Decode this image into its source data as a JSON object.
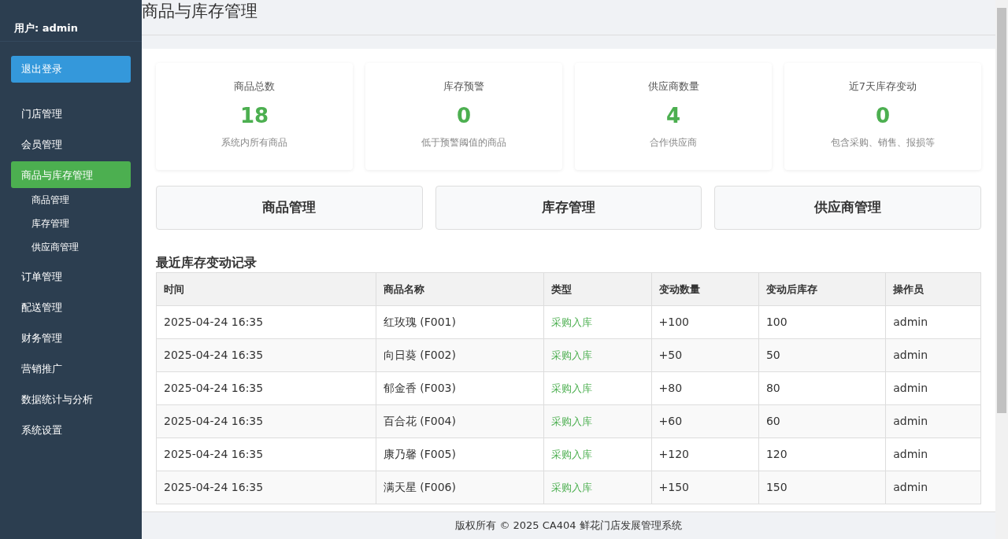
{
  "sidebar": {
    "user": "用户: admin",
    "logout": "退出登录",
    "items": [
      {
        "label": "门店管理",
        "selected": false
      },
      {
        "label": "会员管理",
        "selected": false
      },
      {
        "label": "商品与库存管理",
        "selected": true,
        "children": [
          {
            "label": "商品管理"
          },
          {
            "label": "库存管理"
          },
          {
            "label": "供应商管理"
          }
        ]
      },
      {
        "label": "订单管理",
        "selected": false
      },
      {
        "label": "配送管理",
        "selected": false
      },
      {
        "label": "财务管理",
        "selected": false
      },
      {
        "label": "营销推广",
        "selected": false
      },
      {
        "label": "数据统计与分析",
        "selected": false
      },
      {
        "label": "系统设置",
        "selected": false
      }
    ]
  },
  "page_title": "商品与库存管理",
  "stats": [
    {
      "title": "商品总数",
      "value": "18",
      "note": "系统内所有商品"
    },
    {
      "title": "库存预警",
      "value": "0",
      "note": "低于预警阈值的商品"
    },
    {
      "title": "供应商数量",
      "value": "4",
      "note": "合作供应商"
    },
    {
      "title": "近7天库存变动",
      "value": "0",
      "note": "包含采购、销售、报损等"
    }
  ],
  "quick_links": [
    "商品管理",
    "库存管理",
    "供应商管理"
  ],
  "table": {
    "title": "最近库存变动记录",
    "columns": [
      "时间",
      "商品名称",
      "类型",
      "变动数量",
      "变动后库存",
      "操作员"
    ],
    "rows": [
      [
        "2025-04-24 16:35",
        "红玫瑰 (F001)",
        "采购入库",
        "+100",
        "100",
        "admin"
      ],
      [
        "2025-04-24 16:35",
        "向日葵 (F002)",
        "采购入库",
        "+50",
        "50",
        "admin"
      ],
      [
        "2025-04-24 16:35",
        "郁金香 (F003)",
        "采购入库",
        "+80",
        "80",
        "admin"
      ],
      [
        "2025-04-24 16:35",
        "百合花 (F004)",
        "采购入库",
        "+60",
        "60",
        "admin"
      ],
      [
        "2025-04-24 16:35",
        "康乃馨 (F005)",
        "采购入库",
        "+120",
        "120",
        "admin"
      ],
      [
        "2025-04-24 16:35",
        "满天星 (F006)",
        "采购入库",
        "+150",
        "150",
        "admin"
      ]
    ]
  },
  "footer": "版权所有 © 2025 CA404 鲜花门店发展管理系统"
}
